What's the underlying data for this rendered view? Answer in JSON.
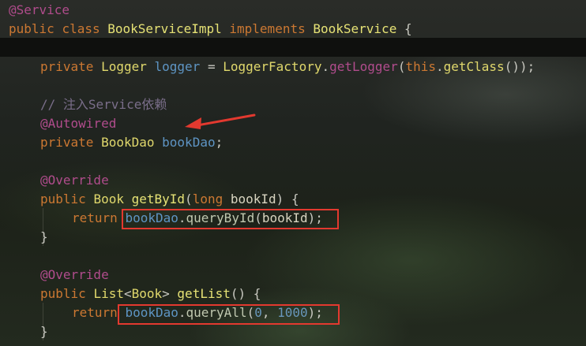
{
  "colors": {
    "keyword": "#cc7832",
    "annotation": "#bbb529",
    "type": "#e0d86c",
    "field": "#5e95c4",
    "comment": "#7a6e8a",
    "highlight_box": "#e3392f"
  },
  "code": {
    "l1_ann": "@Service",
    "l2_kw1": "public",
    "l2_kw2": "class",
    "l2_name": "BookServiceImpl",
    "l2_kw3": "implements",
    "l2_iface": "BookService",
    "l2_brace": "{",
    "l4_kw": "private",
    "l4_type": "Logger",
    "l4_field": "logger",
    "l4_eq": "=",
    "l4_cls": "LoggerFactory",
    "l4_dot": ".",
    "l4_mth": "getLogger",
    "l4_open": "(",
    "l4_this": "this",
    "l4_dot2": ".",
    "l4_mth2": "getClass",
    "l4_close": "());",
    "l6_comment": "// 注入Service依赖",
    "l7_ann": "@Autowired",
    "l8_kw": "private",
    "l8_type": "BookDao",
    "l8_field": "bookDao",
    "l8_semi": ";",
    "l10_ann": "@Override",
    "l11_kw": "public",
    "l11_type": "Book",
    "l11_mth": "getById",
    "l11_open": "(",
    "l11_ptype": "long",
    "l11_param": "bookId",
    "l11_close": ")",
    "l11_brace": "{",
    "l12_kw": "return",
    "l12_field": "bookDao",
    "l12_dot": ".",
    "l12_mth": "queryById",
    "l12_open": "(",
    "l12_arg": "bookId",
    "l12_close": ");",
    "l13_brace": "}",
    "l15_ann": "@Override",
    "l16_kw": "public",
    "l16_type": "List",
    "l16_lt": "<",
    "l16_gen": "Book",
    "l16_gt": ">",
    "l16_mth": "getList",
    "l16_parens": "()",
    "l16_brace": "{",
    "l17_kw": "return",
    "l17_field": "bookDao",
    "l17_dot": ".",
    "l17_mth": "queryAll",
    "l17_open": "(",
    "l17_n1": "0",
    "l17_comma": ",",
    "l17_n2": "1000",
    "l17_close": ");",
    "l18_brace": "}"
  }
}
